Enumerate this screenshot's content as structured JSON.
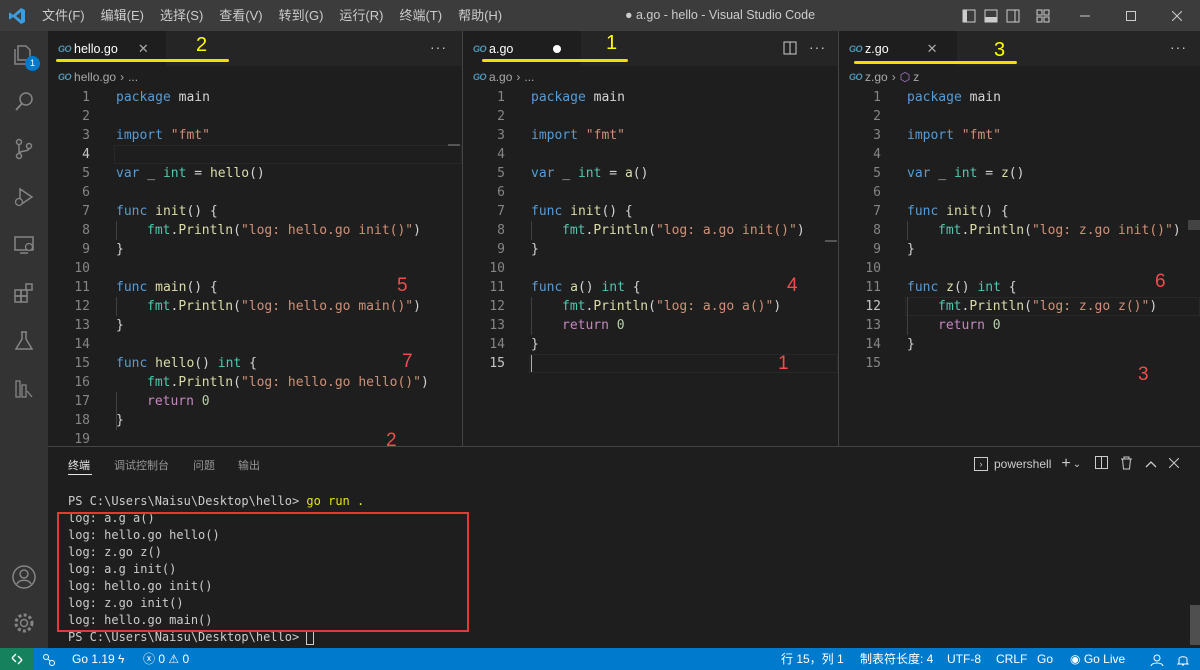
{
  "window": {
    "title": "● a.go - hello - Visual Studio Code"
  },
  "menu": [
    "文件(F)",
    "编辑(E)",
    "选择(S)",
    "查看(V)",
    "转到(G)",
    "运行(R)",
    "终端(T)",
    "帮助(H)"
  ],
  "activity": {
    "explorer_badge": "1"
  },
  "groups": [
    {
      "tab": "hello.go",
      "breadcrumb": "hello.go",
      "breadcrumb_tail": "...",
      "lines": [
        "1",
        "2",
        "3",
        "4",
        "5",
        "6",
        "7",
        "8",
        "9",
        "10",
        "11",
        "12",
        "13",
        "14",
        "15",
        "16",
        "17",
        "18",
        "19"
      ]
    },
    {
      "tab": "a.go",
      "breadcrumb": "a.go",
      "breadcrumb_tail": "...",
      "lines": [
        "1",
        "2",
        "3",
        "4",
        "5",
        "6",
        "7",
        "8",
        "9",
        "10",
        "11",
        "12",
        "13",
        "14",
        "15"
      ]
    },
    {
      "tab": "z.go",
      "breadcrumb": "z.go",
      "breadcrumb_symbol": "z",
      "lines": [
        "1",
        "2",
        "3",
        "4",
        "5",
        "6",
        "7",
        "8",
        "9",
        "10",
        "11",
        "12",
        "13",
        "14",
        "15"
      ]
    }
  ],
  "code": {
    "hello": {
      "pkg_kw": "package",
      "pkg_name": "main",
      "import_kw": "import",
      "import_str": "\"fmt\"",
      "var_kw": "var",
      "var_blank": "_",
      "var_type": "int",
      "var_eq": "=",
      "var_call": "hello",
      "var_parens": "()",
      "func_kw": "func",
      "init_name": "init",
      "sig_open": "() {",
      "pkg_fmt": "fmt",
      "println": "Println",
      "init_str": "\"log: hello.go init()\"",
      "close": "}",
      "main_name": "main",
      "main_str": "\"log: hello.go main()\"",
      "hello_name": "hello",
      "hello_sig": "() int {",
      "hello_str": "\"log: hello.go hello()\"",
      "return_kw": "return",
      "zero": "0"
    },
    "a": {
      "var_call": "a",
      "init_str": "\"log: a.go init()\"",
      "a_name": "a",
      "a_str": "\"log: a.go a()\""
    },
    "z": {
      "var_call": "z",
      "init_str": "\"log: z.go init()\"",
      "z_name": "z",
      "z_str": "\"log: z.go z()\""
    }
  },
  "annotations": {
    "tab_order": [
      "2",
      "1",
      "3"
    ],
    "group1": [
      "5",
      "7",
      "2"
    ],
    "group2": [
      "4",
      "1"
    ],
    "group3": [
      "6",
      "3"
    ]
  },
  "panel": {
    "tabs": [
      "终端",
      "调试控制台",
      "问题",
      "输出"
    ],
    "shell": "powershell",
    "prompt1": "PS C:\\Users\\Naisu\\Desktop\\hello>",
    "cmd": "go run .",
    "output": [
      "log: a.g a()",
      "log: hello.go hello()",
      "log: z.go z()",
      "log: a.g init()",
      "log: hello.go init()",
      "log: z.go init()",
      "log: hello.go main()"
    ],
    "prompt2": "PS C:\\Users\\Naisu\\Desktop\\hello>"
  },
  "status": {
    "go_version": "Go 1.19",
    "errors": "0",
    "warnings": "0",
    "position": "行 15，列 1",
    "tab_size": "制表符长度: 4",
    "encoding": "UTF-8",
    "eol": "CRLF",
    "language": "Go",
    "go_live": "Go Live"
  },
  "colors": {
    "accent": "#007acc",
    "annotation_red": "#f14c4c",
    "annotation_yellow": "#ffff00"
  }
}
